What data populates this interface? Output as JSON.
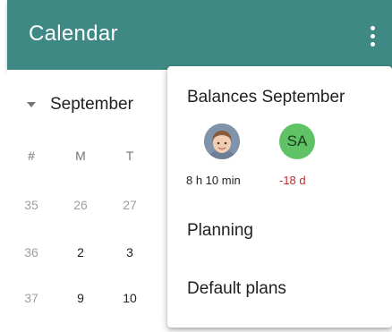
{
  "app_bar": {
    "title": "Calendar"
  },
  "calendar": {
    "month_label": "September",
    "column_headers": [
      "#",
      "M",
      "T"
    ],
    "rows": [
      {
        "week": "35",
        "days": [
          "26",
          "27"
        ]
      },
      {
        "week": "36",
        "days": [
          "2",
          "3"
        ]
      },
      {
        "week": "37",
        "days": [
          "9",
          "10"
        ]
      }
    ]
  },
  "menu": {
    "heading": "Balances September",
    "balances": [
      {
        "avatar": "photo",
        "value": "8 h 10 min"
      },
      {
        "avatar": "SA",
        "value": "-18 d"
      }
    ],
    "items": [
      {
        "label": "Planning"
      },
      {
        "label": "Default plans"
      }
    ]
  },
  "colors": {
    "app_bar": "#3f8985",
    "avatar_green": "#5fc365",
    "negative_value": "#c62828"
  },
  "icons": {
    "menu": "more-vert-icon",
    "month_toggle": "caret-down-icon"
  }
}
